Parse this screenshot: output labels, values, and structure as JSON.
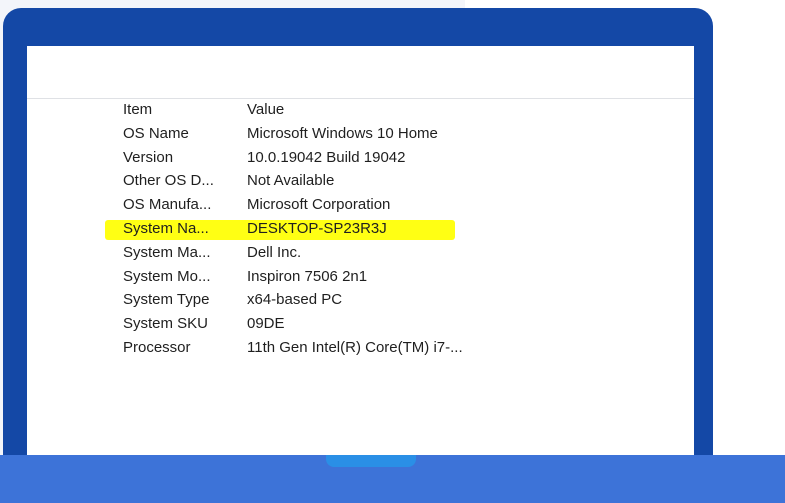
{
  "table": {
    "header": {
      "item": "Item",
      "value": "Value"
    },
    "rows": [
      {
        "item": "OS Name",
        "value": "Microsoft Windows 10 Home"
      },
      {
        "item": "Version",
        "value": "10.0.19042 Build 19042"
      },
      {
        "item": "Other OS D...",
        "value": "Not Available"
      },
      {
        "item": "OS Manufa...",
        "value": "Microsoft Corporation"
      },
      {
        "item": "System Na...",
        "value": "DESKTOP-SP23R3J"
      },
      {
        "item": "System Ma...",
        "value": "Dell Inc."
      },
      {
        "item": "System Mo...",
        "value": "Inspiron 7506 2n1"
      },
      {
        "item": "System Type",
        "value": "x64-based PC"
      },
      {
        "item": "System SKU",
        "value": "09DE"
      },
      {
        "item": "Processor",
        "value": "11th Gen Intel(R) Core(TM) i7-..."
      }
    ],
    "highlighted_row_index": 4,
    "highlight_color": "#ffff14"
  },
  "colors": {
    "laptop_frame": "#1448a6",
    "bottom_bar": "#3d73d8",
    "bottom_tab": "#2a8fe6"
  }
}
